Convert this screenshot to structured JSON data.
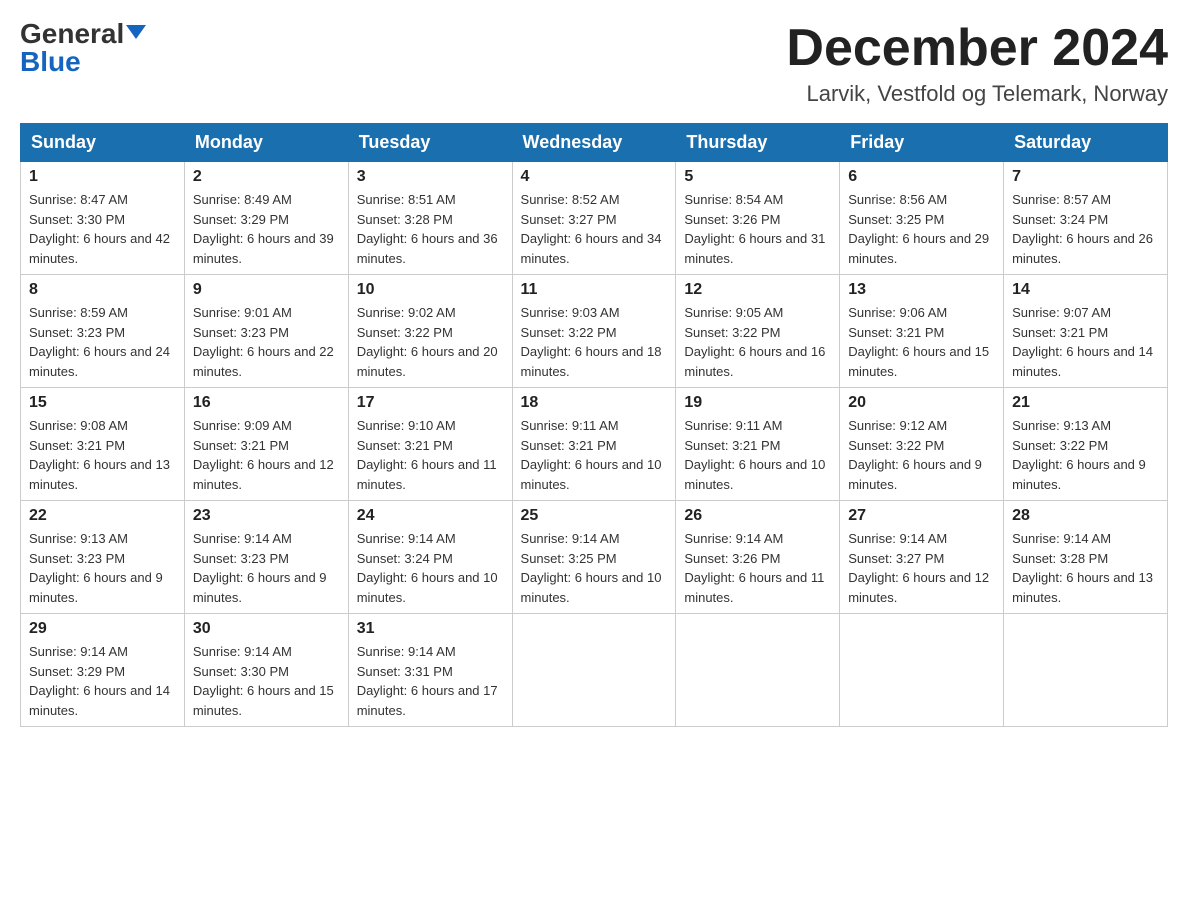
{
  "logo": {
    "general": "General",
    "blue": "Blue"
  },
  "title": {
    "month": "December 2024",
    "location": "Larvik, Vestfold og Telemark, Norway"
  },
  "weekdays": [
    "Sunday",
    "Monday",
    "Tuesday",
    "Wednesday",
    "Thursday",
    "Friday",
    "Saturday"
  ],
  "weeks": [
    [
      {
        "day": "1",
        "sunrise": "8:47 AM",
        "sunset": "3:30 PM",
        "daylight": "6 hours and 42 minutes."
      },
      {
        "day": "2",
        "sunrise": "8:49 AM",
        "sunset": "3:29 PM",
        "daylight": "6 hours and 39 minutes."
      },
      {
        "day": "3",
        "sunrise": "8:51 AM",
        "sunset": "3:28 PM",
        "daylight": "6 hours and 36 minutes."
      },
      {
        "day": "4",
        "sunrise": "8:52 AM",
        "sunset": "3:27 PM",
        "daylight": "6 hours and 34 minutes."
      },
      {
        "day": "5",
        "sunrise": "8:54 AM",
        "sunset": "3:26 PM",
        "daylight": "6 hours and 31 minutes."
      },
      {
        "day": "6",
        "sunrise": "8:56 AM",
        "sunset": "3:25 PM",
        "daylight": "6 hours and 29 minutes."
      },
      {
        "day": "7",
        "sunrise": "8:57 AM",
        "sunset": "3:24 PM",
        "daylight": "6 hours and 26 minutes."
      }
    ],
    [
      {
        "day": "8",
        "sunrise": "8:59 AM",
        "sunset": "3:23 PM",
        "daylight": "6 hours and 24 minutes."
      },
      {
        "day": "9",
        "sunrise": "9:01 AM",
        "sunset": "3:23 PM",
        "daylight": "6 hours and 22 minutes."
      },
      {
        "day": "10",
        "sunrise": "9:02 AM",
        "sunset": "3:22 PM",
        "daylight": "6 hours and 20 minutes."
      },
      {
        "day": "11",
        "sunrise": "9:03 AM",
        "sunset": "3:22 PM",
        "daylight": "6 hours and 18 minutes."
      },
      {
        "day": "12",
        "sunrise": "9:05 AM",
        "sunset": "3:22 PM",
        "daylight": "6 hours and 16 minutes."
      },
      {
        "day": "13",
        "sunrise": "9:06 AM",
        "sunset": "3:21 PM",
        "daylight": "6 hours and 15 minutes."
      },
      {
        "day": "14",
        "sunrise": "9:07 AM",
        "sunset": "3:21 PM",
        "daylight": "6 hours and 14 minutes."
      }
    ],
    [
      {
        "day": "15",
        "sunrise": "9:08 AM",
        "sunset": "3:21 PM",
        "daylight": "6 hours and 13 minutes."
      },
      {
        "day": "16",
        "sunrise": "9:09 AM",
        "sunset": "3:21 PM",
        "daylight": "6 hours and 12 minutes."
      },
      {
        "day": "17",
        "sunrise": "9:10 AM",
        "sunset": "3:21 PM",
        "daylight": "6 hours and 11 minutes."
      },
      {
        "day": "18",
        "sunrise": "9:11 AM",
        "sunset": "3:21 PM",
        "daylight": "6 hours and 10 minutes."
      },
      {
        "day": "19",
        "sunrise": "9:11 AM",
        "sunset": "3:21 PM",
        "daylight": "6 hours and 10 minutes."
      },
      {
        "day": "20",
        "sunrise": "9:12 AM",
        "sunset": "3:22 PM",
        "daylight": "6 hours and 9 minutes."
      },
      {
        "day": "21",
        "sunrise": "9:13 AM",
        "sunset": "3:22 PM",
        "daylight": "6 hours and 9 minutes."
      }
    ],
    [
      {
        "day": "22",
        "sunrise": "9:13 AM",
        "sunset": "3:23 PM",
        "daylight": "6 hours and 9 minutes."
      },
      {
        "day": "23",
        "sunrise": "9:14 AM",
        "sunset": "3:23 PM",
        "daylight": "6 hours and 9 minutes."
      },
      {
        "day": "24",
        "sunrise": "9:14 AM",
        "sunset": "3:24 PM",
        "daylight": "6 hours and 10 minutes."
      },
      {
        "day": "25",
        "sunrise": "9:14 AM",
        "sunset": "3:25 PM",
        "daylight": "6 hours and 10 minutes."
      },
      {
        "day": "26",
        "sunrise": "9:14 AM",
        "sunset": "3:26 PM",
        "daylight": "6 hours and 11 minutes."
      },
      {
        "day": "27",
        "sunrise": "9:14 AM",
        "sunset": "3:27 PM",
        "daylight": "6 hours and 12 minutes."
      },
      {
        "day": "28",
        "sunrise": "9:14 AM",
        "sunset": "3:28 PM",
        "daylight": "6 hours and 13 minutes."
      }
    ],
    [
      {
        "day": "29",
        "sunrise": "9:14 AM",
        "sunset": "3:29 PM",
        "daylight": "6 hours and 14 minutes."
      },
      {
        "day": "30",
        "sunrise": "9:14 AM",
        "sunset": "3:30 PM",
        "daylight": "6 hours and 15 minutes."
      },
      {
        "day": "31",
        "sunrise": "9:14 AM",
        "sunset": "3:31 PM",
        "daylight": "6 hours and 17 minutes."
      },
      null,
      null,
      null,
      null
    ]
  ]
}
